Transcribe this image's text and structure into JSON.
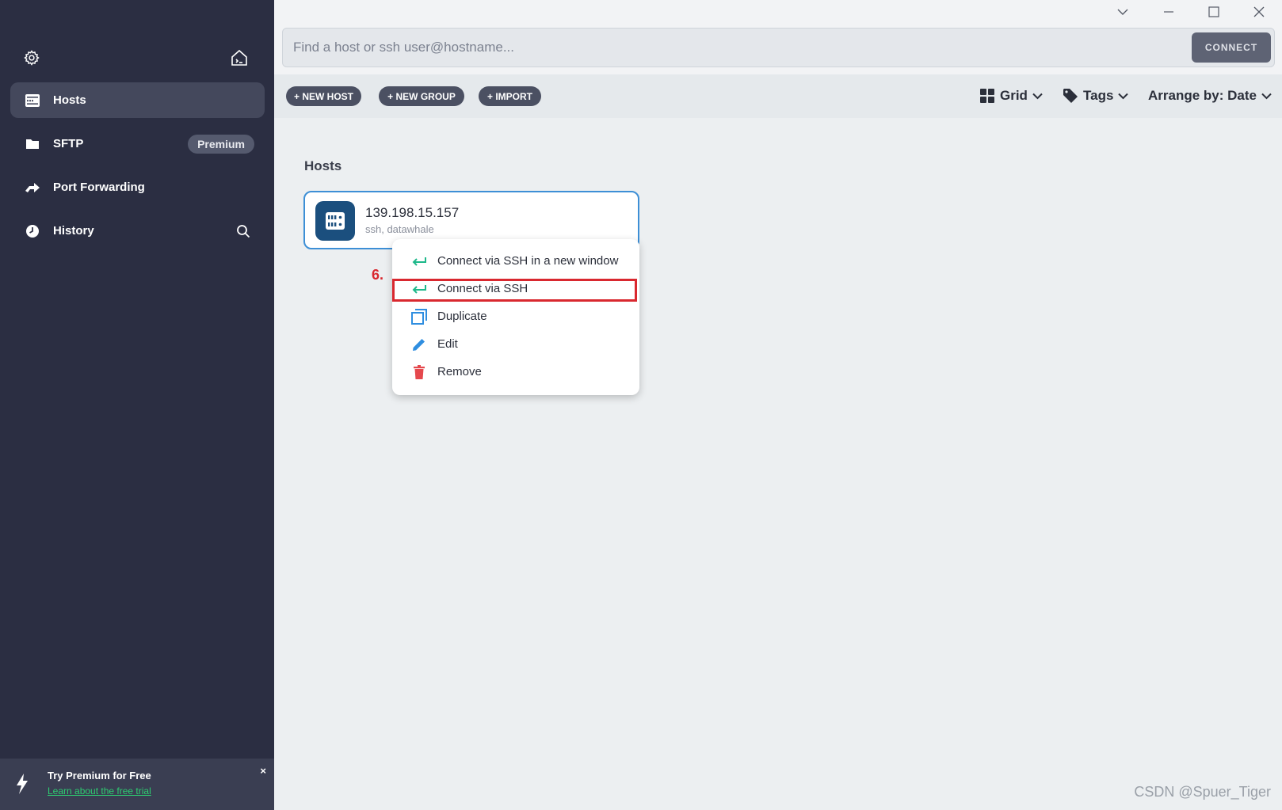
{
  "sidebar": {
    "settings_icon": "gear-icon",
    "home_icon": "terminal-home-icon",
    "items": [
      {
        "label": "Hosts",
        "icon": "server-icon",
        "active": true
      },
      {
        "label": "SFTP",
        "icon": "folder-icon",
        "badge": "Premium"
      },
      {
        "label": "Port Forwarding",
        "icon": "port-forward-icon"
      },
      {
        "label": "History",
        "icon": "clock-icon"
      }
    ],
    "promo": {
      "title": "Try Premium for Free",
      "link": "Learn about the free trial",
      "close": "×"
    }
  },
  "search": {
    "placeholder": "Find a host or ssh user@hostname...",
    "connect_label": "CONNECT"
  },
  "toolbar": {
    "new_host": "+ NEW HOST",
    "new_group": "+ NEW GROUP",
    "import": "+ IMPORT",
    "view_label": "Grid",
    "tags_label": "Tags",
    "arrange_label": "Arrange by: Date"
  },
  "main": {
    "section_title": "Hosts",
    "host": {
      "name": "139.198.15.157",
      "subtitle": "ssh, datawhale"
    },
    "context_menu": [
      {
        "label": "Connect via SSH in a new window",
        "icon": "enter-arrow-icon"
      },
      {
        "label": "Connect via SSH",
        "icon": "enter-arrow-icon"
      },
      {
        "label": "Duplicate",
        "icon": "duplicate-icon"
      },
      {
        "label": "Edit",
        "icon": "pencil-icon"
      },
      {
        "label": "Remove",
        "icon": "trash-icon"
      }
    ],
    "step_label": "6."
  },
  "watermark": "CSDN @Spuer_Tiger",
  "colors": {
    "sidebar_bg": "#2b2e42",
    "accent_blue": "#3d8fd6",
    "highlight_red": "#d9282f",
    "connect_green": "#2ecc71",
    "remove_red": "#e5484d"
  }
}
